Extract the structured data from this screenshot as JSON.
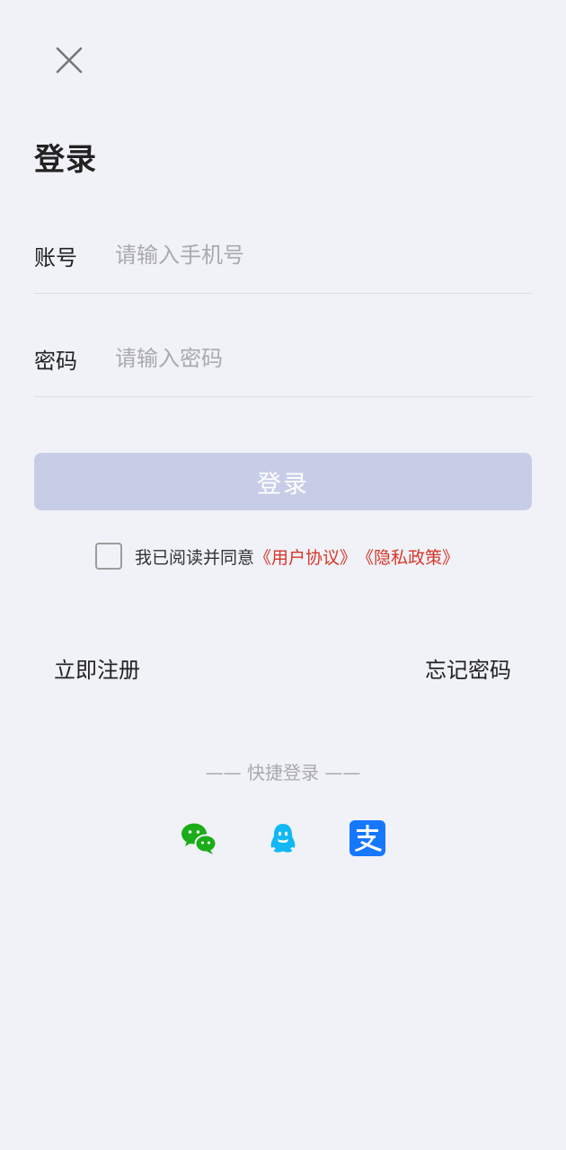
{
  "header": {
    "close_icon": "close-icon",
    "title": "登录"
  },
  "form": {
    "account_label": "账号",
    "account_placeholder": "请输入手机号",
    "password_label": "密码",
    "password_placeholder": "请输入密码",
    "login_button_label": "登录"
  },
  "agreement": {
    "checked": false,
    "text": "我已阅读并同意",
    "user_agreement_link": "《用户协议》",
    "privacy_policy_link": "《隐私政策》",
    "link_color": "#d5372a"
  },
  "links": {
    "register": "立即注册",
    "forgot_password": "忘记密码"
  },
  "quick_login": {
    "title": "—— 快捷登录 ——",
    "providers": [
      {
        "icon": "wechat-icon",
        "color": "#1aad19"
      },
      {
        "icon": "qq-icon",
        "color": "#12b7f5"
      },
      {
        "icon": "alipay-icon",
        "color": "#1677ff"
      }
    ]
  },
  "colors": {
    "background": "#f0f2f7",
    "login_button_disabled": "#c8cde7"
  }
}
